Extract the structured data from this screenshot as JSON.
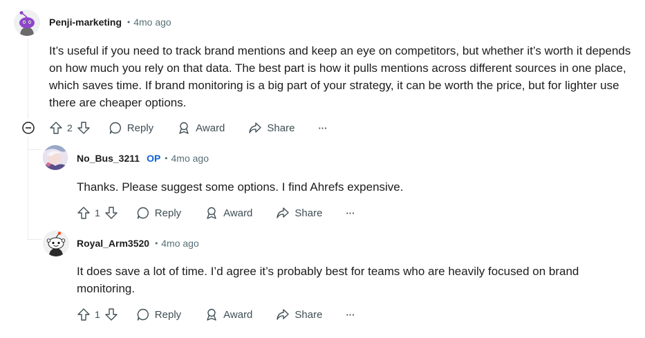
{
  "comments": [
    {
      "username": "Penji-marketing",
      "time": "4mo ago",
      "body": "It’s useful if you need to track brand mentions and keep an eye on competitors, but whether it’s worth it depends on how much you rely on that data. The best part is how it pulls mentions across different sources in one place, which saves time. If brand monitoring is a big part of your strategy, it can be worth the price, but for lighter use there are cheaper options.",
      "votes": "2",
      "reply_label": "Reply",
      "award_label": "Award",
      "share_label": "Share",
      "more_label": "···"
    },
    {
      "username": "No_Bus_3211",
      "op_badge": "OP",
      "time": "4mo ago",
      "body": "Thanks. Please suggest some options. I find Ahrefs expensive.",
      "votes": "1",
      "reply_label": "Reply",
      "award_label": "Award",
      "share_label": "Share",
      "more_label": "···"
    },
    {
      "username": "Royal_Arm3520",
      "time": "4mo ago",
      "body": "It does save a lot of time. I’d agree it’s probably best for teams who are heavily focused on brand monitoring.",
      "votes": "1",
      "reply_label": "Reply",
      "award_label": "Award",
      "share_label": "Share",
      "more_label": "···"
    }
  ],
  "colors": {
    "text": "#1c1c1c",
    "meta": "#576f76",
    "op": "#0a61d6",
    "thread_line": "#e5ebee"
  },
  "icons": [
    "upvote-icon",
    "downvote-icon",
    "reply-icon",
    "award-icon",
    "share-icon",
    "more-icon",
    "collapse-icon"
  ]
}
